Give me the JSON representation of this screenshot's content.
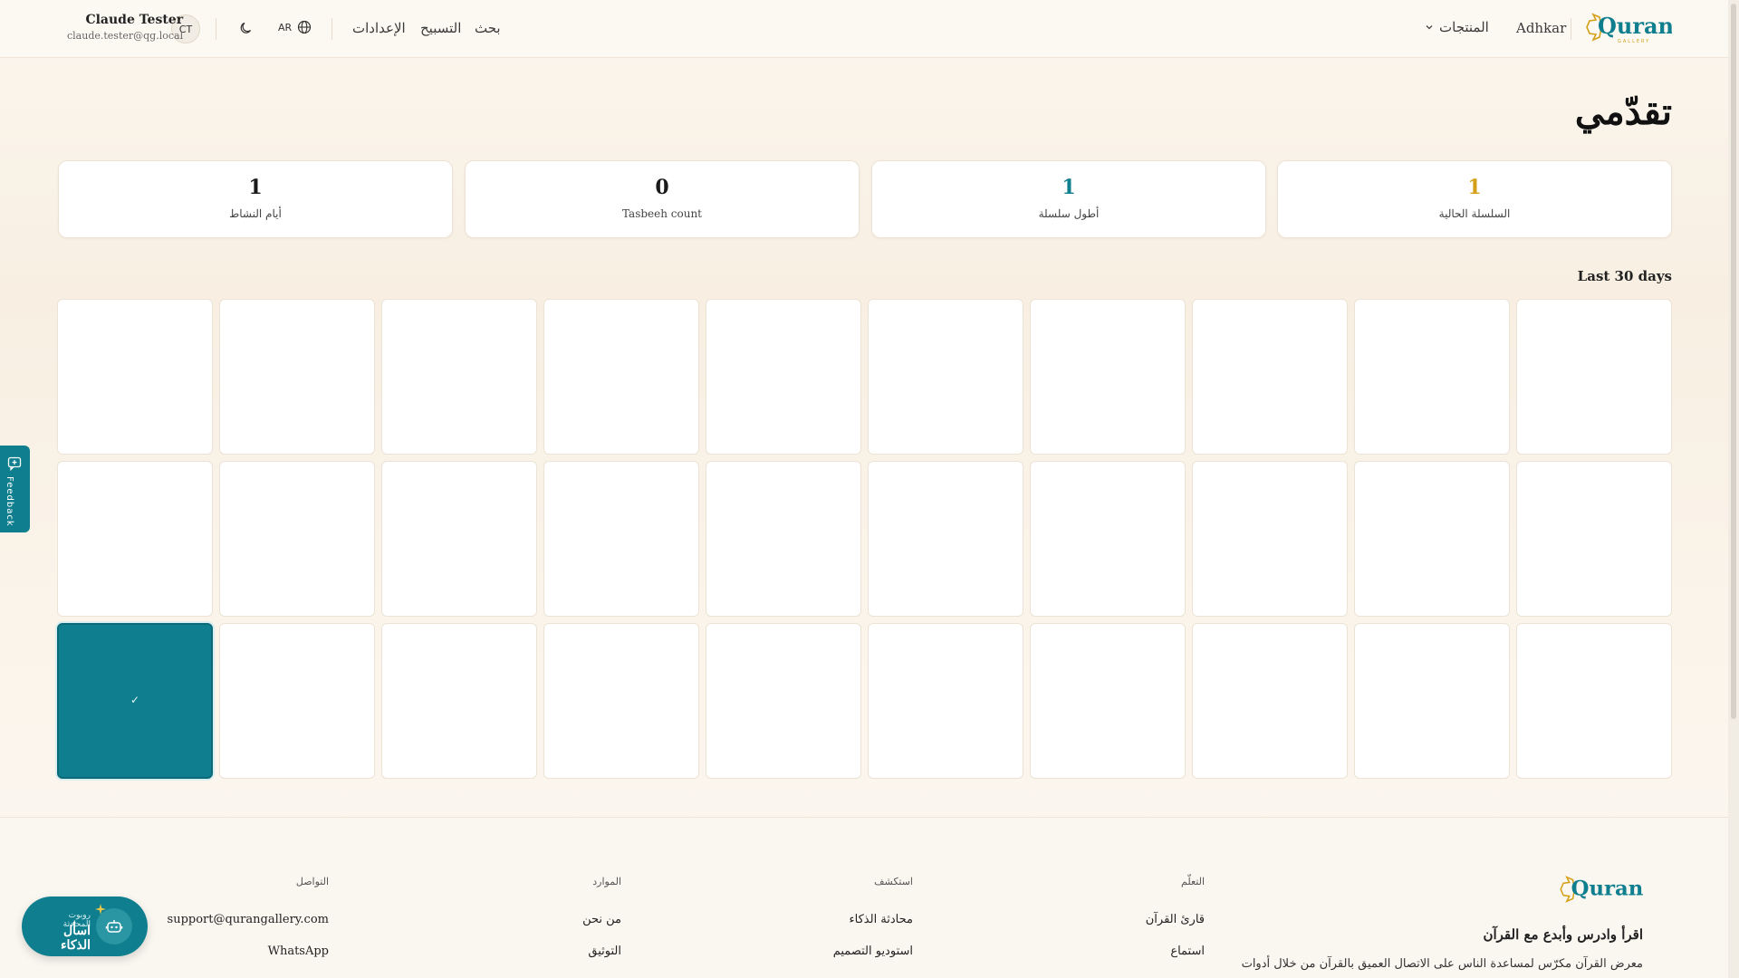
{
  "header": {
    "logo_text": "Quran",
    "logo_subtext": "GALLERY",
    "adhkar": "Adhkar",
    "products": "المنتجات",
    "search": "بحث",
    "tasbeeh": "التسبيح",
    "settings": "الإعدادات",
    "language": "AR",
    "user_name": "Claude Tester",
    "user_email": "claude.tester@qg.local",
    "avatar_initials": "CT"
  },
  "page": {
    "title": "تقدّمي",
    "section_label": "Last 30 days"
  },
  "stats": [
    {
      "value": "1",
      "label": "السلسلة الحالية",
      "color": "#d4a017"
    },
    {
      "value": "1",
      "label": "أطول سلسلة",
      "color": "#0f7f8f"
    },
    {
      "value": "0",
      "label": "Tasbeeh count",
      "color": "#1a1a1a"
    },
    {
      "value": "1",
      "label": "أيام النشاط",
      "color": "#1a1a1a"
    }
  ],
  "days": {
    "total": 30,
    "active_day_index": 29,
    "check_glyph": "✓"
  },
  "feedback": {
    "label": "Feedback"
  },
  "ai_button": {
    "small": "روبوت المحادثة",
    "main": "اسأل الذكاء"
  },
  "footer": {
    "logo_text": "Quran",
    "tagline": "اقرأ وادرس وأبدع مع القرآن",
    "about": "معرض القرآن مكرّس لمساعدة الناس على الاتصال العميق بالقرآن من خلال أدوات",
    "columns": [
      {
        "title": "التعلّم",
        "items": [
          "قارئ القرآن",
          "استماع"
        ]
      },
      {
        "title": "استكشف",
        "items": [
          "محادثة الذكاء",
          "استوديو التصميم"
        ]
      },
      {
        "title": "الموارد",
        "items": [
          "من نحن",
          "التوثيق"
        ]
      },
      {
        "title": "التواصل",
        "items": [
          "support@qurangallery.com",
          "WhatsApp"
        ]
      }
    ]
  },
  "colors": {
    "accent": "#0f7f8f",
    "gold": "#d4a017"
  }
}
